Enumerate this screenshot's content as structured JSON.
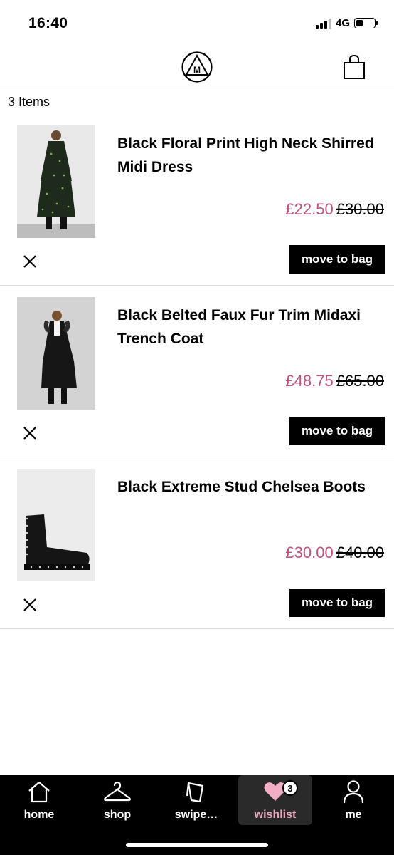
{
  "status": {
    "time": "16:40",
    "network": "4G"
  },
  "header": {
    "logo_letter": "M"
  },
  "wishlist": {
    "count_label": "3 Items",
    "items": [
      {
        "title": "Black Floral Print High Neck Shirred Midi Dress",
        "price": "£22.50",
        "old_price": "£30.00",
        "action_label": "move to bag"
      },
      {
        "title": "Black Belted Faux Fur Trim Midaxi Trench Coat",
        "price": "£48.75",
        "old_price": "£65.00",
        "action_label": "move to bag"
      },
      {
        "title": "Black Extreme Stud Chelsea Boots",
        "price": "£30.00",
        "old_price": "£40.00",
        "action_label": "move to bag"
      }
    ]
  },
  "tabs": [
    {
      "label": "home",
      "icon": "home-icon"
    },
    {
      "label": "shop",
      "icon": "hanger-icon"
    },
    {
      "label": "swipe…",
      "icon": "cards-icon"
    },
    {
      "label": "wishlist",
      "icon": "heart-icon",
      "badge": "3",
      "active": true
    },
    {
      "label": "me",
      "icon": "person-icon"
    }
  ],
  "colors": {
    "sale_price": "#c0517f",
    "active_tab_label": "#e7a8c0",
    "tab_bar": "#000000"
  }
}
